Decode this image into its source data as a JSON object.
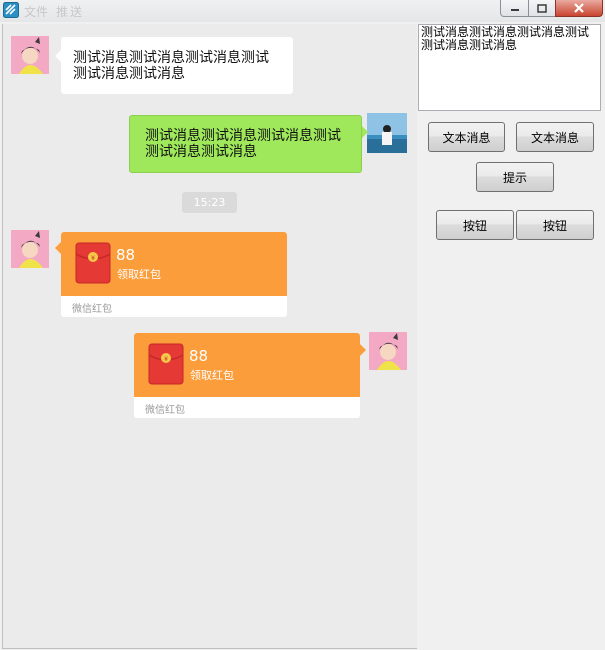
{
  "window": {
    "ghost_text_1": "文",
    "ghost_text_2": "件",
    "ghost_text_3": "推",
    "ghost_text_4": "送"
  },
  "messages": [
    {
      "side": "left",
      "type": "text",
      "text": "测试消息测试消息测试消息测试测试消息测试消息"
    },
    {
      "side": "right",
      "type": "text",
      "text": "测试消息测试消息测试消息测试测试消息测试消息"
    },
    {
      "type": "time",
      "text": "15:23"
    },
    {
      "side": "left",
      "type": "hongbao",
      "amount": "88",
      "subtitle": "领取红包",
      "footer": "微信红包"
    },
    {
      "side": "right",
      "type": "hongbao",
      "amount": "88",
      "subtitle": "领取红包",
      "footer": "微信红包"
    }
  ],
  "panel": {
    "textbox_value": "测试消息测试消息测试消息测试测试消息测试消息",
    "btn_text_left": "文本消息",
    "btn_text_right": "文本消息",
    "btn_hint": "提示",
    "btn_left": "按钮",
    "btn_right": "按钮"
  },
  "colors": {
    "chat_bg": "#ebebeb",
    "green_bubble": "#9fe85b",
    "hongbao_orange": "#fb9d3b",
    "hongbao_red": "#e53935"
  }
}
